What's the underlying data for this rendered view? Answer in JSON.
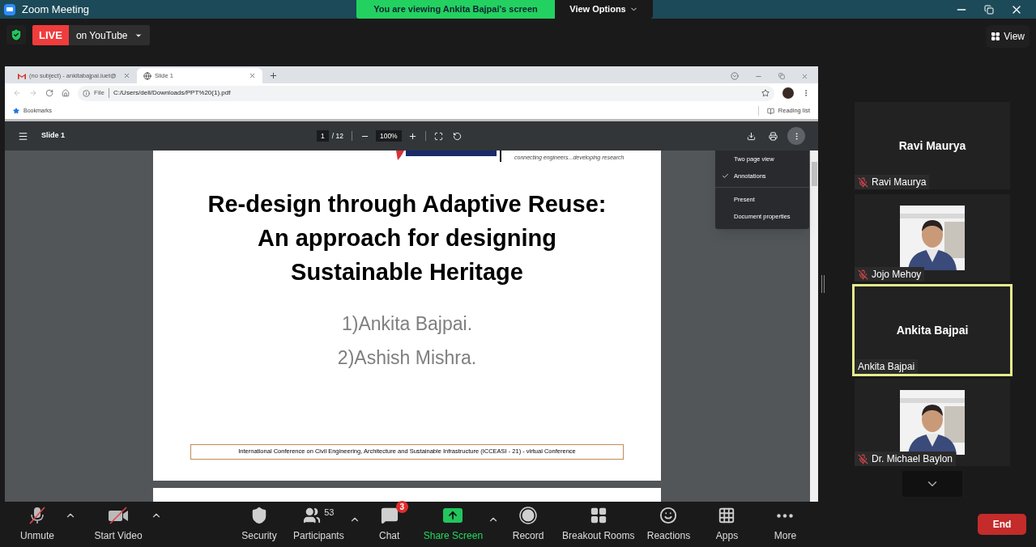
{
  "window": {
    "title": "Zoom Meeting"
  },
  "banner": {
    "text": "You are viewing Ankita Bajpai's screen",
    "options": "View Options"
  },
  "live": {
    "badge": "LIVE",
    "target": "on YouTube"
  },
  "view_button": "View",
  "browser": {
    "tabs": [
      {
        "title": "(no subject) - ankitabajpai.iuet@",
        "selected": false
      },
      {
        "title": "Slide 1",
        "selected": true
      }
    ],
    "address": {
      "scheme": "File",
      "url": "C:/Users/dell/Downloads/PPT%20(1).pdf"
    },
    "bookmarks": "Bookmarks",
    "reading_list": "Reading list"
  },
  "pdf": {
    "title": "Slide 1",
    "page": "1",
    "pages": "/ 12",
    "zoom": "100%",
    "menu": [
      [
        {
          "label": "Two page view",
          "checked": false
        },
        {
          "label": "Annotations",
          "checked": true
        }
      ],
      [
        {
          "label": "Present",
          "checked": false
        },
        {
          "label": "Document properties",
          "checked": false
        }
      ]
    ],
    "slide": {
      "tagline": "connecting engineers...developing research",
      "title": [
        "Re-design through Adaptive Reuse:",
        "An approach for designing",
        "Sustainable Heritage"
      ],
      "authors": [
        "1)Ankita Bajpai.",
        "2)Ashish Mishra."
      ],
      "footer": "International Conference on Civil Engineering, Architecture and Sustainable Infrastructure (ICCEASI - 21) - virtual Conference"
    }
  },
  "participants": [
    {
      "caption": "Ravi Maurya",
      "name": "Ravi Maurya",
      "muted": true,
      "speaking": false,
      "video": false
    },
    {
      "name": "Jojo Mehoy",
      "muted": true,
      "speaking": false,
      "video": true
    },
    {
      "caption": "Ankita Bajpai",
      "name": "Ankita Bajpai",
      "muted": false,
      "speaking": true,
      "video": false
    },
    {
      "name": "Dr. Michael Baylon",
      "muted": true,
      "speaking": false,
      "video": true
    }
  ],
  "toolbar": {
    "audio": {
      "label": "Unmute",
      "muted": true
    },
    "video": {
      "label": "Start Video",
      "off": true
    },
    "items": [
      {
        "label": "Security",
        "caret": false,
        "active": false
      },
      {
        "label": "Participants",
        "caret": true,
        "active": false,
        "count": "53"
      },
      {
        "label": "Chat",
        "caret": false,
        "active": false,
        "badge": "3"
      },
      {
        "label": "Share Screen",
        "caret": true,
        "active": true
      },
      {
        "label": "Record",
        "caret": false,
        "active": false
      },
      {
        "label": "Breakout Rooms",
        "caret": false,
        "active": false
      },
      {
        "label": "Reactions",
        "caret": false,
        "active": false
      },
      {
        "label": "Apps",
        "caret": false,
        "active": false
      },
      {
        "label": "More",
        "caret": false,
        "active": false
      }
    ],
    "end": "End"
  }
}
